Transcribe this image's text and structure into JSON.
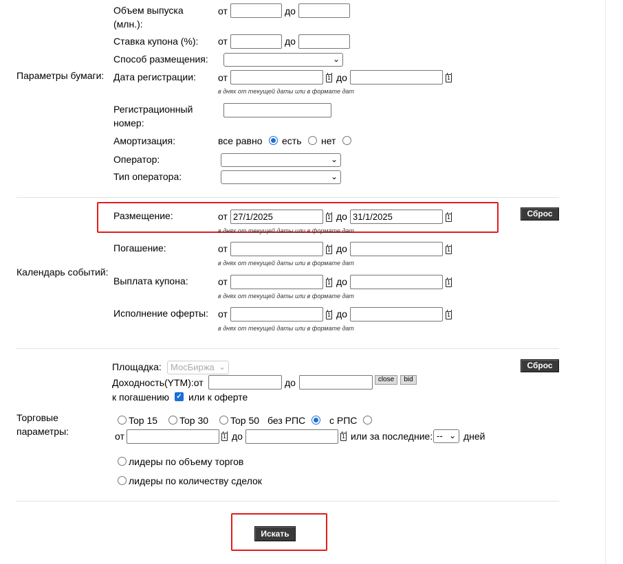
{
  "paper": {
    "section_label": "Параметры бумаги:",
    "volume_label": "Объем выпуска (млн.):",
    "coupon_label": "Ставка купона (%):",
    "placement_method_label": "Способ размещения:",
    "reg_date_label": "Дата регистрации:",
    "reg_number_label": "Регистрационный номер:",
    "amort_label": "Амортизация:",
    "amort_opt_any": "все равно",
    "amort_opt_yes": "есть",
    "amort_opt_no": "нет",
    "operator_label": "Оператор:",
    "operator_type_label": "Тип оператора:"
  },
  "common": {
    "from": "от",
    "to": "до",
    "date_hint": "в днях от текущей даты или в формате дат",
    "calendar_glyph": "1"
  },
  "calendar": {
    "section_label": "Календарь событий:",
    "placement_label": "Размещение:",
    "placement_from": "27/1/2025",
    "placement_to": "31/1/2025",
    "maturity_label": "Погашение:",
    "coupon_pay_label": "Выплата купона:",
    "offer_label": "Исполнение оферты:",
    "reset_label": "Сброс"
  },
  "trading": {
    "section_label": "Торговые параметры:",
    "venue_label": "Площадка:",
    "venue_value": "МосБиржа",
    "yield_label": "Доходность(YTM):от",
    "to_label": "до",
    "close_btn": "close",
    "bid_btn": "bid",
    "to_maturity_label": "к погашению",
    "or_offer_label": "или к оферте",
    "top15": "Top 15",
    "top30": "Top 30",
    "top50": "Top 50",
    "no_rps": "без РПС",
    "with_rps": "с РПС",
    "or_last_label": "или за последние:",
    "last_value": "--",
    "days_label": "дней",
    "leaders_volume": "лидеры по объему торгов",
    "leaders_deals": "лидеры по количеству сделок",
    "reset_label": "Сброс"
  },
  "search_button": "Искать",
  "colors": {
    "highlight": "#e31b1b",
    "radio_accent": "#1a6ed8",
    "dark_button": "#3a3a3a"
  }
}
